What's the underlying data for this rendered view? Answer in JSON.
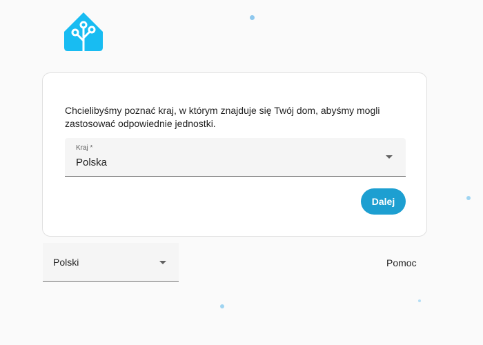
{
  "app": {
    "logo_icon": "home-assistant-logo-icon",
    "logo_color": "#18bcf2"
  },
  "onboarding": {
    "intro_text": "Chcielibyśmy poznać kraj, w którym znajduje się Twój dom, abyśmy mogli zastosować odpowiednie jednostki.",
    "country_field": {
      "label": "Kraj *",
      "value": "Polska"
    },
    "next_button_label": "Dalej",
    "accent_color": "#1d9fd1"
  },
  "footer": {
    "language_value": "Polski",
    "help_label": "Pomoc"
  }
}
